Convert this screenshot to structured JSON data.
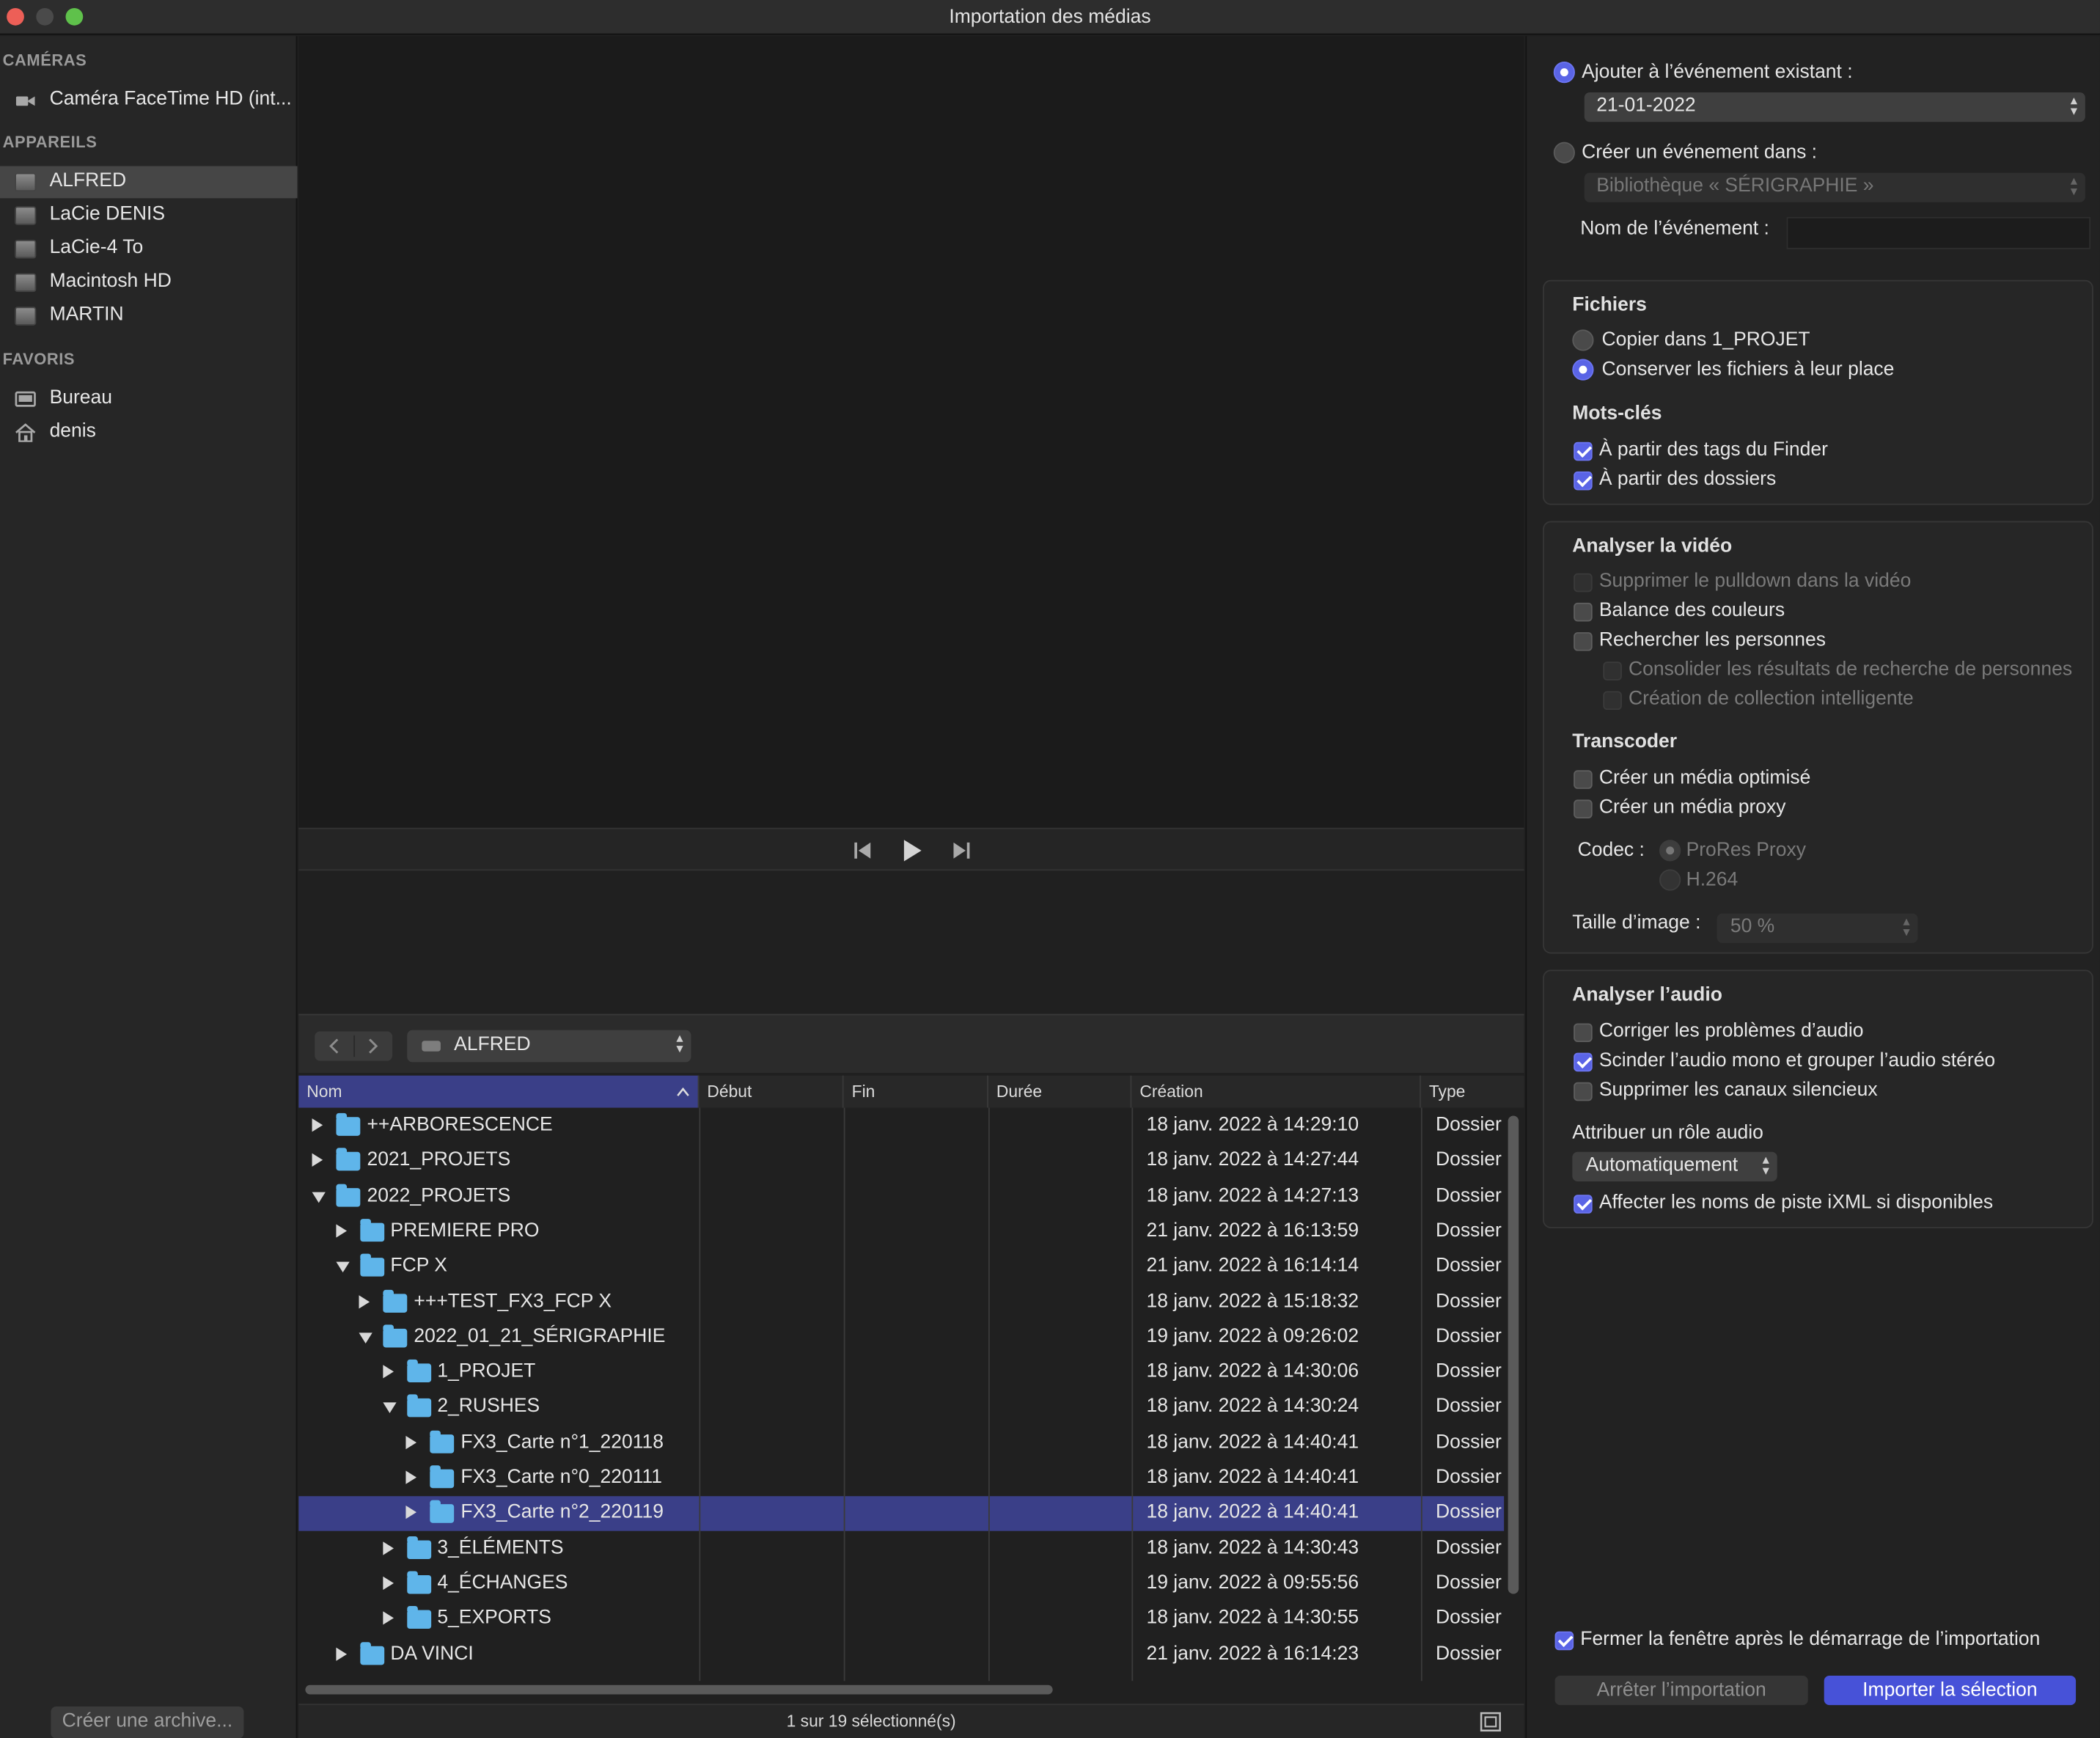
{
  "window": {
    "title": "Importation des médias"
  },
  "sidebar": {
    "cameras_header": "CAMÉRAS",
    "cameras": [
      {
        "label": "Caméra FaceTime HD (int..."
      }
    ],
    "devices_header": "APPAREILS",
    "devices": [
      {
        "label": "ALFRED"
      },
      {
        "label": "LaCie DENIS"
      },
      {
        "label": "LaCie-4 To"
      },
      {
        "label": "Macintosh HD"
      },
      {
        "label": "MARTIN"
      }
    ],
    "favorites_header": "FAVORIS",
    "favorites": [
      {
        "label": "Bureau"
      },
      {
        "label": "denis"
      }
    ],
    "create_archive": "Créer une archive..."
  },
  "navbar": {
    "location": "ALFRED"
  },
  "browser": {
    "columns": [
      "Nom",
      "Début",
      "Fin",
      "Durée",
      "Création",
      "Type"
    ],
    "rows": [
      {
        "name": "++ARBORESCENCE",
        "created": "18 janv. 2022 à 14:29:10",
        "type": "Dossier"
      },
      {
        "name": "2021_PROJETS",
        "created": "18 janv. 2022 à 14:27:44",
        "type": "Dossier"
      },
      {
        "name": "2022_PROJETS",
        "created": "18 janv. 2022 à 14:27:13",
        "type": "Dossier"
      },
      {
        "name": "PREMIERE PRO",
        "created": "21 janv. 2022 à 16:13:59",
        "type": "Dossier"
      },
      {
        "name": "FCP X",
        "created": "21 janv. 2022 à 16:14:14",
        "type": "Dossier"
      },
      {
        "name": "+++TEST_FX3_FCP X",
        "created": "18 janv. 2022 à 15:18:32",
        "type": "Dossier"
      },
      {
        "name": "2022_01_21_SÉRIGRAPHIE",
        "created": "19 janv. 2022 à 09:26:02",
        "type": "Dossier"
      },
      {
        "name": "1_PROJET",
        "created": "18 janv. 2022 à 14:30:06",
        "type": "Dossier"
      },
      {
        "name": "2_RUSHES",
        "created": "18 janv. 2022 à 14:30:24",
        "type": "Dossier"
      },
      {
        "name": "FX3_Carte n°1_220118",
        "created": "18 janv. 2022 à 14:40:41",
        "type": "Dossier"
      },
      {
        "name": "FX3_Carte n°0_220111",
        "created": "18 janv. 2022 à 14:40:41",
        "type": "Dossier"
      },
      {
        "name": "FX3_Carte n°2_220119",
        "created": "18 janv. 2022 à 14:40:41",
        "type": "Dossier"
      },
      {
        "name": "3_ÉLÉMENTS",
        "created": "18 janv. 2022 à 14:30:43",
        "type": "Dossier"
      },
      {
        "name": "4_ÉCHANGES",
        "created": "19 janv. 2022 à 09:55:56",
        "type": "Dossier"
      },
      {
        "name": "5_EXPORTS",
        "created": "18 janv. 2022 à 14:30:55",
        "type": "Dossier"
      },
      {
        "name": "DA VINCI",
        "created": "21 janv. 2022 à 16:14:23",
        "type": "Dossier"
      }
    ],
    "status": "1 sur 19 sélectionné(s)"
  },
  "options": {
    "add_existing_label": "Ajouter à l’événement existant :",
    "existing_event": "21-01-2022",
    "create_event_label": "Créer un événement dans :",
    "library": "Bibliothèque « SÉRIGRAPHIE »",
    "event_name_label": "Nom de l’événement :",
    "event_name_value": "",
    "files_header": "Fichiers",
    "copy_to": "Copier dans 1_PROJET",
    "keep_in_place": "Conserver les fichiers à leur place",
    "keywords_header": "Mots-clés",
    "from_finder_tags": "À partir des tags du Finder",
    "from_folders": "À partir des dossiers",
    "analyze_video_header": "Analyser la vidéo",
    "remove_pulldown": "Supprimer le pulldown dans la vidéo",
    "color_balance": "Balance des couleurs",
    "find_people": "Rechercher les personnes",
    "consolidate_people": "Consolider les résultats de recherche de personnes",
    "smart_collection": "Création de collection intelligente",
    "transcode_header": "Transcoder",
    "optimized_media": "Créer un média optimisé",
    "proxy_media": "Créer un média proxy",
    "codec_label": "Codec :",
    "codec_prores": "ProRes Proxy",
    "codec_h264": "H.264",
    "frame_size_label": "Taille d’image :",
    "frame_size_value": "50 %",
    "analyze_audio_header": "Analyser l’audio",
    "fix_audio": "Corriger les problèmes d’audio",
    "split_mono": "Scinder l’audio mono et grouper l’audio stéréo",
    "remove_silent": "Supprimer les canaux silencieux",
    "assign_role_label": "Attribuer un rôle audio",
    "role_value": "Automatiquement",
    "ixml_names": "Affecter les noms de piste iXML si disponibles",
    "close_after": "Fermer la fenêtre après le démarrage de l’importation",
    "stop_import": "Arrêter l’importation",
    "import_selection": "Importer la sélection"
  },
  "colors": {
    "accent": "#5a64e6",
    "selection": "#3a3f88",
    "folder": "#5fb5ea"
  }
}
